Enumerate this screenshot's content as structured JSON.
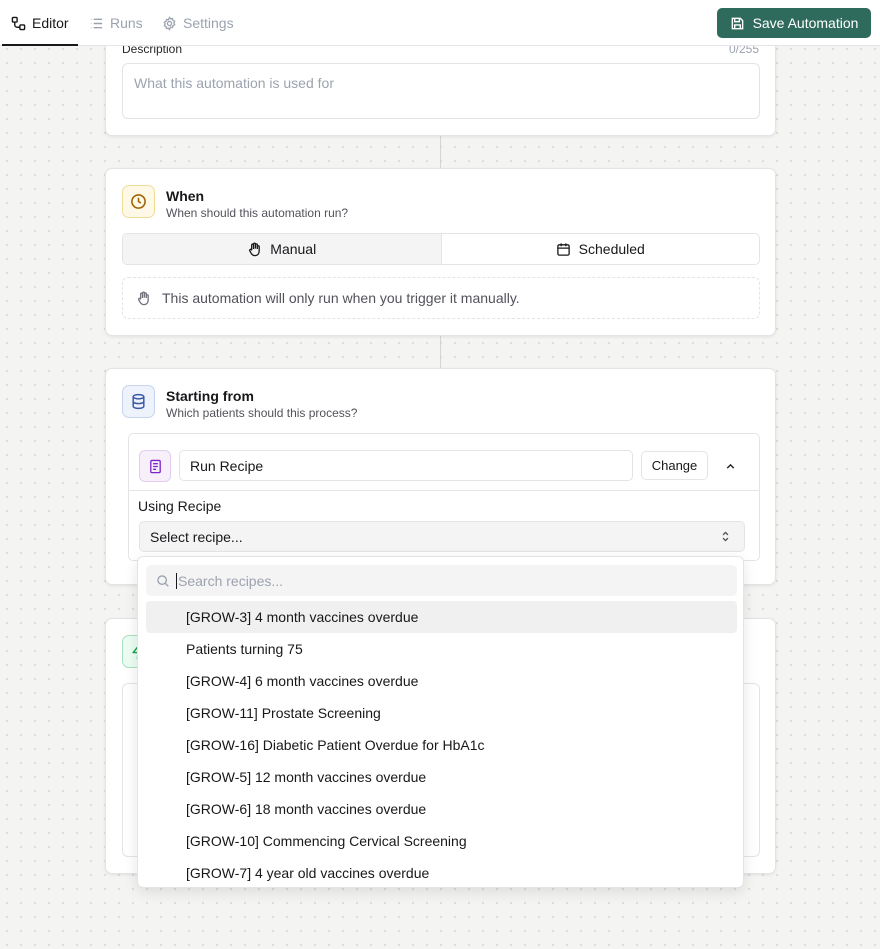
{
  "tabs": [
    {
      "label": "Editor",
      "icon": "workflow-icon",
      "active": true
    },
    {
      "label": "Runs",
      "icon": "list-icon",
      "active": false
    },
    {
      "label": "Settings",
      "icon": "gear-icon",
      "active": false
    }
  ],
  "save_button": {
    "label": "Save Automation",
    "icon": "save-icon",
    "color": "#2f6b5c"
  },
  "description": {
    "label": "Description",
    "counter": "0/255",
    "placeholder": "What this automation is used for"
  },
  "when": {
    "title": "When",
    "subtitle": "When should this automation run?",
    "options": [
      {
        "label": "Manual",
        "icon": "hand-icon",
        "selected": true
      },
      {
        "label": "Scheduled",
        "icon": "calendar-icon",
        "selected": false
      }
    ],
    "note": "This automation will only run when you trigger it manually."
  },
  "starting_from": {
    "title": "Starting from",
    "subtitle": "Which patients should this process?",
    "step_name": "Run Recipe",
    "change_label": "Change",
    "using_label": "Using Recipe",
    "select_placeholder": "Select recipe..."
  },
  "recipe_dropdown": {
    "search_placeholder": "Search recipes...",
    "options": [
      "[GROW-3] 4 month vaccines overdue",
      "Patients turning 75",
      "[GROW-4] 6 month vaccines overdue",
      "[GROW-11] Prostate Screening",
      "[GROW-16] Diabetic Patient Overdue for HbA1c",
      "[GROW-5] 12 month vaccines overdue",
      "[GROW-6] 18 month vaccines overdue",
      "[GROW-10] Commencing Cervical Screening",
      "[GROW-7] 4 year old vaccines overdue"
    ],
    "highlighted_index": 0
  }
}
